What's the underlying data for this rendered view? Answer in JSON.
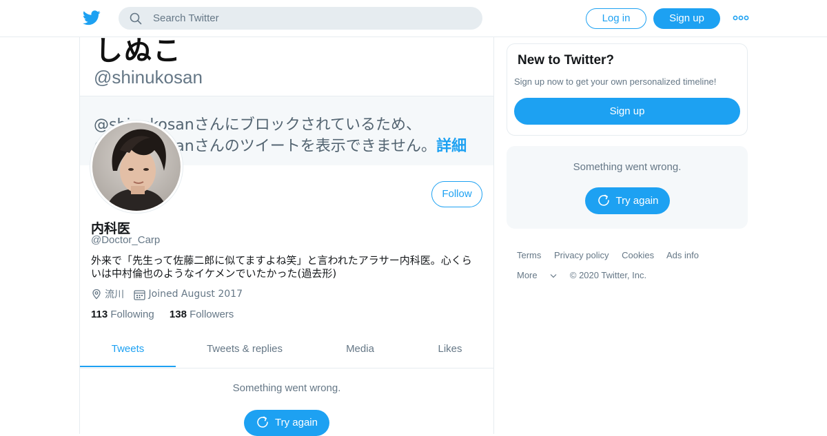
{
  "header": {
    "search_placeholder": "Search Twitter",
    "login_label": "Log in",
    "signup_label": "Sign up"
  },
  "banner": {
    "name": "しぬこ",
    "handle": "@shinukosan",
    "line1": "@shinukosanさんにブロックされているため、",
    "line2": "@shinukosanさんのツイートを表示できません。",
    "link": "詳細"
  },
  "profile": {
    "name": "内科医",
    "handle": "@Doctor_Carp",
    "bio": "外来で「先生って佐藤二郎に似てますよね笑」と言われたアラサー内科医。心くらいは中村倫也のようなイケメンでいたかった(過去形)",
    "location": "流川",
    "joined": "Joined August 2017",
    "following_count": "113",
    "following_label": "Following",
    "followers_count": "138",
    "followers_label": "Followers",
    "follow_label": "Follow"
  },
  "tabs": [
    {
      "label": "Tweets",
      "active": true
    },
    {
      "label": "Tweets & replies"
    },
    {
      "label": "Media"
    },
    {
      "label": "Likes"
    }
  ],
  "timeline": {
    "error": "Something went wrong.",
    "retry": "Try again"
  },
  "sidebar": {
    "new_title": "New to Twitter?",
    "new_sub": "Sign up now to get your own personalized timeline!",
    "signup_label": "Sign up",
    "error": "Something went wrong.",
    "retry": "Try again"
  },
  "footer": {
    "links": [
      "Terms",
      "Privacy policy",
      "Cookies",
      "Ads info"
    ],
    "more": "More",
    "copyright": "© 2020 Twitter, Inc."
  },
  "colors": {
    "accent": "#1da1f2",
    "border": "#e6ecf0",
    "muted": "#657786",
    "text": "#14171a"
  }
}
